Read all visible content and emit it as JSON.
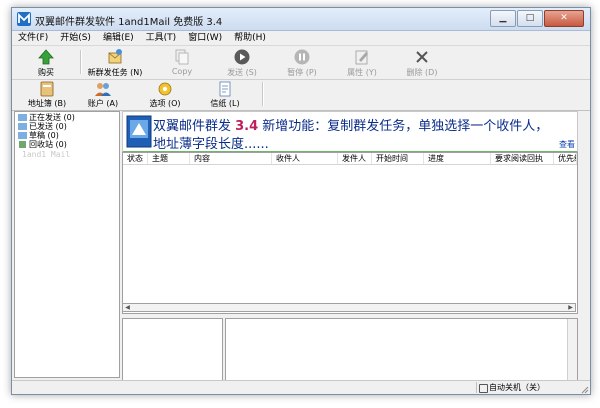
{
  "window": {
    "title": "双翼邮件群发软件 1and1Mail 免费版 3.4"
  },
  "menu": [
    "文件(F)",
    "开始(S)",
    "编辑(E)",
    "工具(T)",
    "窗口(W)",
    "帮助(H)"
  ],
  "toolbar_main": {
    "buy": "购买",
    "new_task": "新群发任务 (N)",
    "copy": "Copy",
    "send": "发送 (S)",
    "pause": "暂停 (P)",
    "properties": "属性 (Y)",
    "delete": "删除 (D)"
  },
  "toolbar_secondary": {
    "address_book": "地址簿 (B)",
    "accounts": "账户 (A)",
    "options": "选项 (O)",
    "letters": "信纸 (L)"
  },
  "folders": [
    "正在发送 (0)",
    "已发送 (0)",
    "草稿 (0)",
    "回收站 (0)"
  ],
  "folder_watermark": "1and1 Mail",
  "banner": {
    "prefix": "双翼邮件群发 ",
    "version": "3.4",
    "suffix": " 新增功能：复制群发任务，单独选择一个收件人，",
    "line2": "地址薄字段长度......",
    "link": "查看"
  },
  "table": {
    "columns": [
      "状态",
      "主题",
      "内容",
      "收件人",
      "发件人",
      "开始时间",
      "进度",
      "要求阅读回执",
      "优先级"
    ]
  },
  "status": {
    "auto_shutdown": "自动关机（关）"
  }
}
